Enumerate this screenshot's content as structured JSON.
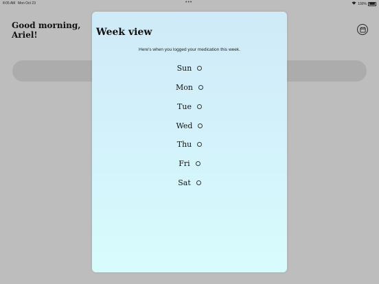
{
  "status": {
    "time": "8:05 AM",
    "date": "Mon Oct 23",
    "battery": "100%"
  },
  "home": {
    "greeting": "Good morning, Ariel!"
  },
  "week_view": {
    "title": "Week view",
    "subtitle": "Here's when you logged your medication this week.",
    "days": [
      "Sun",
      "Mon",
      "Tue",
      "Wed",
      "Thu",
      "Fri",
      "Sat"
    ]
  },
  "colors": {
    "modal_top": "#cfeaf8",
    "modal_bottom": "#d8fdfd",
    "backdrop": "#bdbdbd"
  }
}
